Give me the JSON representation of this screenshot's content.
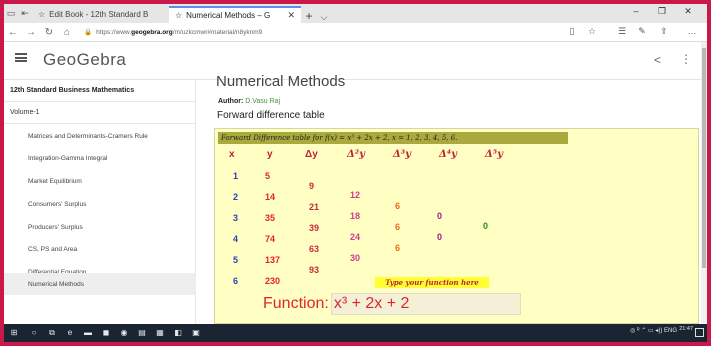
{
  "browser": {
    "tabs": [
      {
        "label": "Edit Book - 12th Standard B",
        "active": false
      },
      {
        "label": "Numerical Methods – G",
        "active": true
      }
    ],
    "url_prefix": "https://www.",
    "url_domain": "geogebra.org",
    "url_path": "/m/uzkcmwr#material/n8yknm9"
  },
  "header": {
    "logo": "GeoGebra"
  },
  "sidebar": {
    "book": "12th Standard Business Mathematics",
    "volume": "Volume-1",
    "items": [
      {
        "label": "Matrices and Determinants-Cramers Rule"
      },
      {
        "label": "Integration-Gamma Integral"
      },
      {
        "label": "Market Equilibrium"
      },
      {
        "label": "Consumers' Surplus"
      },
      {
        "label": "Producers' Surplus"
      },
      {
        "label": "CS, PS and Area"
      },
      {
        "label": "Differential Equation"
      },
      {
        "label": "Numerical Methods",
        "selected": true
      }
    ]
  },
  "main": {
    "title": "Numerical Methods",
    "author_label": "Author:",
    "author_name": "D.Vasu Raj",
    "subtitle": "Forward difference table"
  },
  "applet": {
    "table_title": "Forward Difference table for f(x) = x³ + 2x + 2, x = 1, 2, 3, 4, 5, 6.",
    "headers": [
      "x",
      "y",
      "Δy",
      "Δ²y",
      "Δ³y",
      "Δ⁴y",
      "Δ⁵y"
    ],
    "x": [
      "1",
      "2",
      "3",
      "4",
      "5",
      "6"
    ],
    "y": [
      "5",
      "14",
      "35",
      "74",
      "137",
      "230"
    ],
    "d1": [
      "9",
      "21",
      "39",
      "63",
      "93"
    ],
    "d2": [
      "12",
      "18",
      "24",
      "30"
    ],
    "d3": [
      "6",
      "6",
      "6"
    ],
    "d4": [
      "0",
      "0"
    ],
    "d5": [
      "0"
    ],
    "fn_label": "Type your function here",
    "fn_prefix": "Function:",
    "fn_value": "x³ + 2x + 2"
  },
  "taskbar": {
    "tray_text": "ENG",
    "time": "21:47"
  }
}
